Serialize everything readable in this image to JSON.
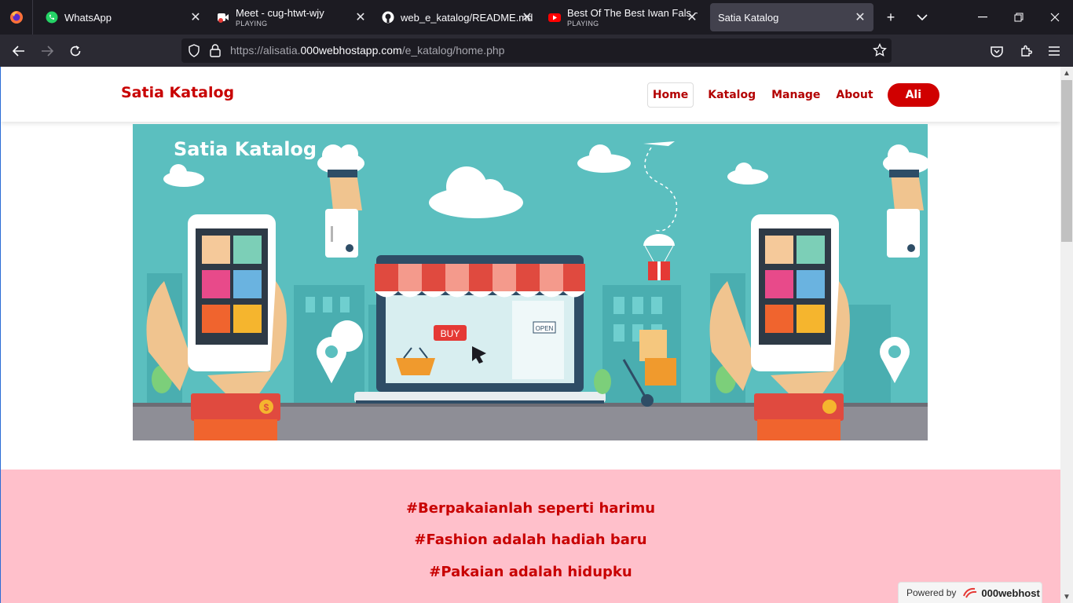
{
  "browser": {
    "tabs": [
      {
        "title": "WhatsApp",
        "sub": "",
        "icon": "whatsapp-icon"
      },
      {
        "title": "Meet - cug-htwt-wjy",
        "sub": "PLAYING",
        "icon": "meet-icon"
      },
      {
        "title": "web_e_katalog/README.md",
        "sub": "",
        "icon": "github-icon"
      },
      {
        "title": "Best Of The Best Iwan Fals ~",
        "sub": "PLAYING",
        "icon": "youtube-icon"
      },
      {
        "title": "Satia Katalog",
        "sub": "",
        "icon": ""
      }
    ],
    "url_prefix": "https://alisatia.",
    "url_host": "000webhostapp.com",
    "url_path": "/e_katalog/home.php"
  },
  "site": {
    "brand": "Satia Katalog",
    "menu": {
      "home": "Home",
      "katalog": "Katalog",
      "manage": "Manage",
      "about": "About",
      "user": "Ali"
    },
    "hero": {
      "title": "Satia Katalog",
      "buy_label": "BUY",
      "open_label": "OPEN",
      "coin_label": "$"
    },
    "quotes": [
      "#Berpakaianlah seperti harimu",
      "#Fashion adalah hadiah baru",
      "#Pakaian adalah hidupku"
    ],
    "powered": {
      "label": "Powered by",
      "brand": "000webhost"
    }
  },
  "colors": {
    "brand_red": "#c80000",
    "hero_teal": "#5bbfbf",
    "quotes_bg": "#ffc0cb"
  }
}
